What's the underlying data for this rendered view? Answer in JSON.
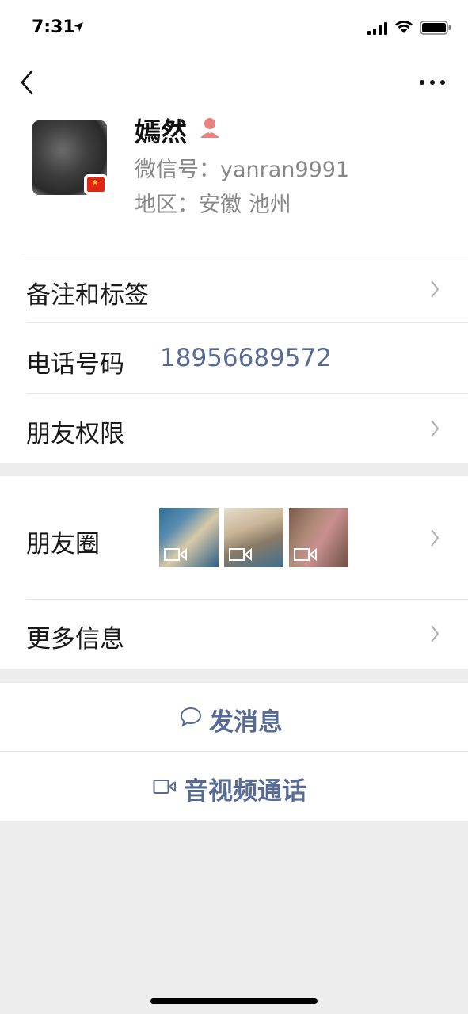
{
  "status_bar": {
    "time": "7:31"
  },
  "header": {
    "back_icon": "chevron-left-icon",
    "more_icon": "more-dots-icon"
  },
  "profile": {
    "nickname": "嫣然",
    "wechat_id": "微信号：yanran9991",
    "region": "地区：安徽  池州",
    "gender_icon_color": "#e8837f"
  },
  "rows": {
    "remark_tags": "备注和标签",
    "phone_label": "电话号码",
    "phone_value": "18956689572",
    "friend_permissions": "朋友权限",
    "moments": "朋友圈",
    "more_info": "更多信息"
  },
  "actions": {
    "send_message": "发消息",
    "video_call": "音视频通话"
  },
  "colors": {
    "link_blue": "#576b95",
    "background_gray": "#ededed",
    "divider": "#e5e5e5"
  }
}
